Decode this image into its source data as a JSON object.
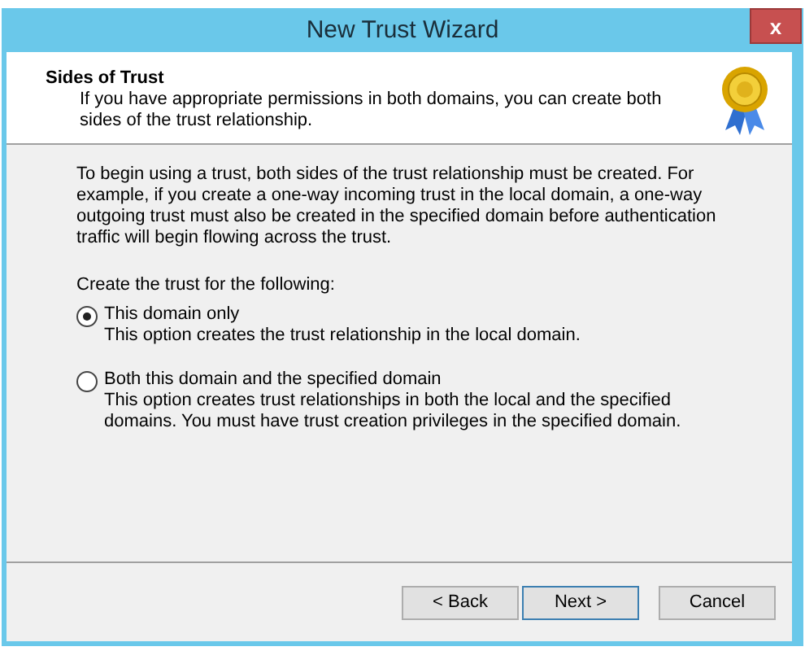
{
  "window": {
    "title": "New Trust Wizard",
    "close": "x"
  },
  "header": {
    "title": "Sides of Trust",
    "subtitle": "If you have appropriate permissions in both domains, you can create both sides of the trust relationship."
  },
  "intro": "To begin using a trust, both sides of the trust relationship must be created. For example, if you create a one-way incoming trust in the local domain, a one-way outgoing trust must also be created in the specified domain before authentication traffic will begin flowing across the trust.",
  "prompt": "Create the trust for the following:",
  "options": [
    {
      "label": "This domain only",
      "description": "This option creates the trust relationship in the local domain.",
      "selected": true
    },
    {
      "label": "Both this domain and the specified domain",
      "description": "This option creates trust relationships in both the local and the specified domains. You must have trust creation privileges in the specified domain.",
      "selected": false
    }
  ],
  "buttons": [
    {
      "label": "< Back",
      "default": false
    },
    {
      "label": "Next >",
      "default": true
    },
    {
      "label": "Cancel",
      "default": false
    }
  ]
}
